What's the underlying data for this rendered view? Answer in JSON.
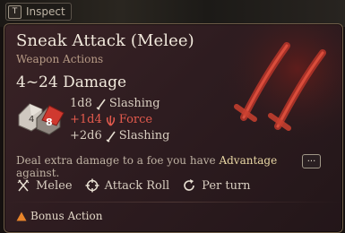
{
  "inspect": {
    "key": "T",
    "label": "Inspect"
  },
  "tooltip": {
    "title": "Sneak Attack (Melee)",
    "subtitle": "Weapon Actions",
    "damage_range": "4~24 Damage",
    "dice_faces": [
      "4",
      "8"
    ],
    "damage_lines": [
      {
        "dice": "1d8",
        "icon": "slashing-icon",
        "type": "Slashing"
      },
      {
        "dice": "+1d4",
        "icon": "force-icon",
        "type": "Force",
        "color": "#e35a4d"
      },
      {
        "dice": "+2d6",
        "icon": "slashing-icon",
        "type": "Slashing"
      }
    ],
    "description_before": "Deal extra damage to a foe you have ",
    "description_keyword": "Advantage",
    "description_after": " against.",
    "more_label": "...",
    "properties": [
      {
        "icon": "melee-swords-icon",
        "label": "Melee"
      },
      {
        "icon": "crosshair-icon",
        "label": "Attack Roll"
      },
      {
        "icon": "refresh-icon",
        "label": "Per turn"
      }
    ],
    "action_cost": {
      "icon": "bonus-action-triangle-icon",
      "label": "Bonus Action",
      "color": "#e8842a"
    }
  }
}
